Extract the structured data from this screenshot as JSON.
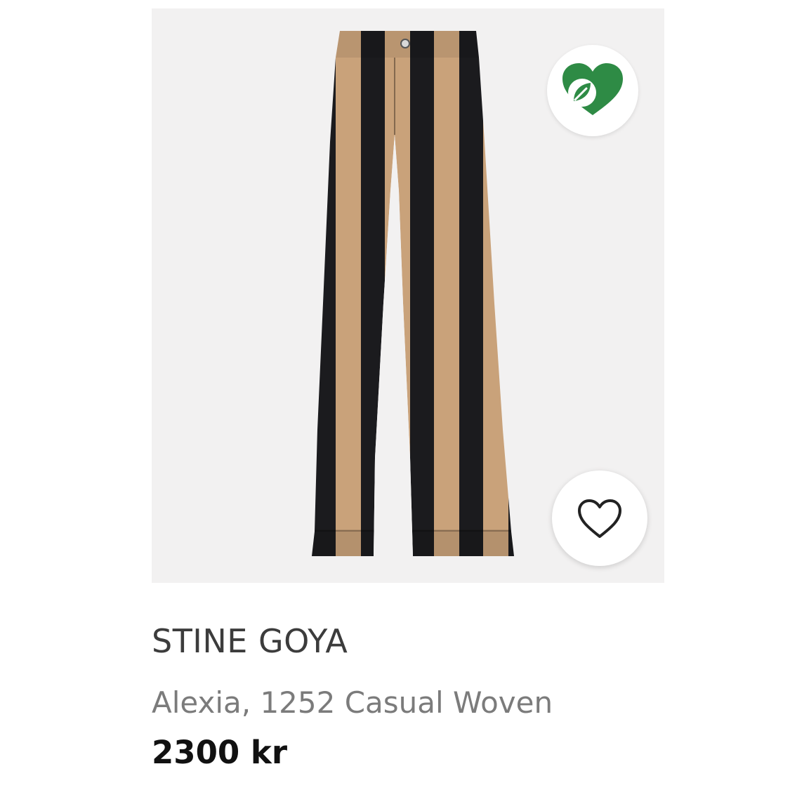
{
  "product": {
    "brand": "STINE GOYA",
    "name": "Alexia, 1252 Casual Woven",
    "price": "2300 kr"
  },
  "icons": {
    "badge": "eco-heart-leaf-icon",
    "favorite": "heart-outline-icon"
  },
  "colors": {
    "eco_green": "#2e8b45",
    "stripe_tan": "#c9a27a",
    "stripe_black": "#1b1b1e",
    "image_background": "#f2f1f1"
  }
}
